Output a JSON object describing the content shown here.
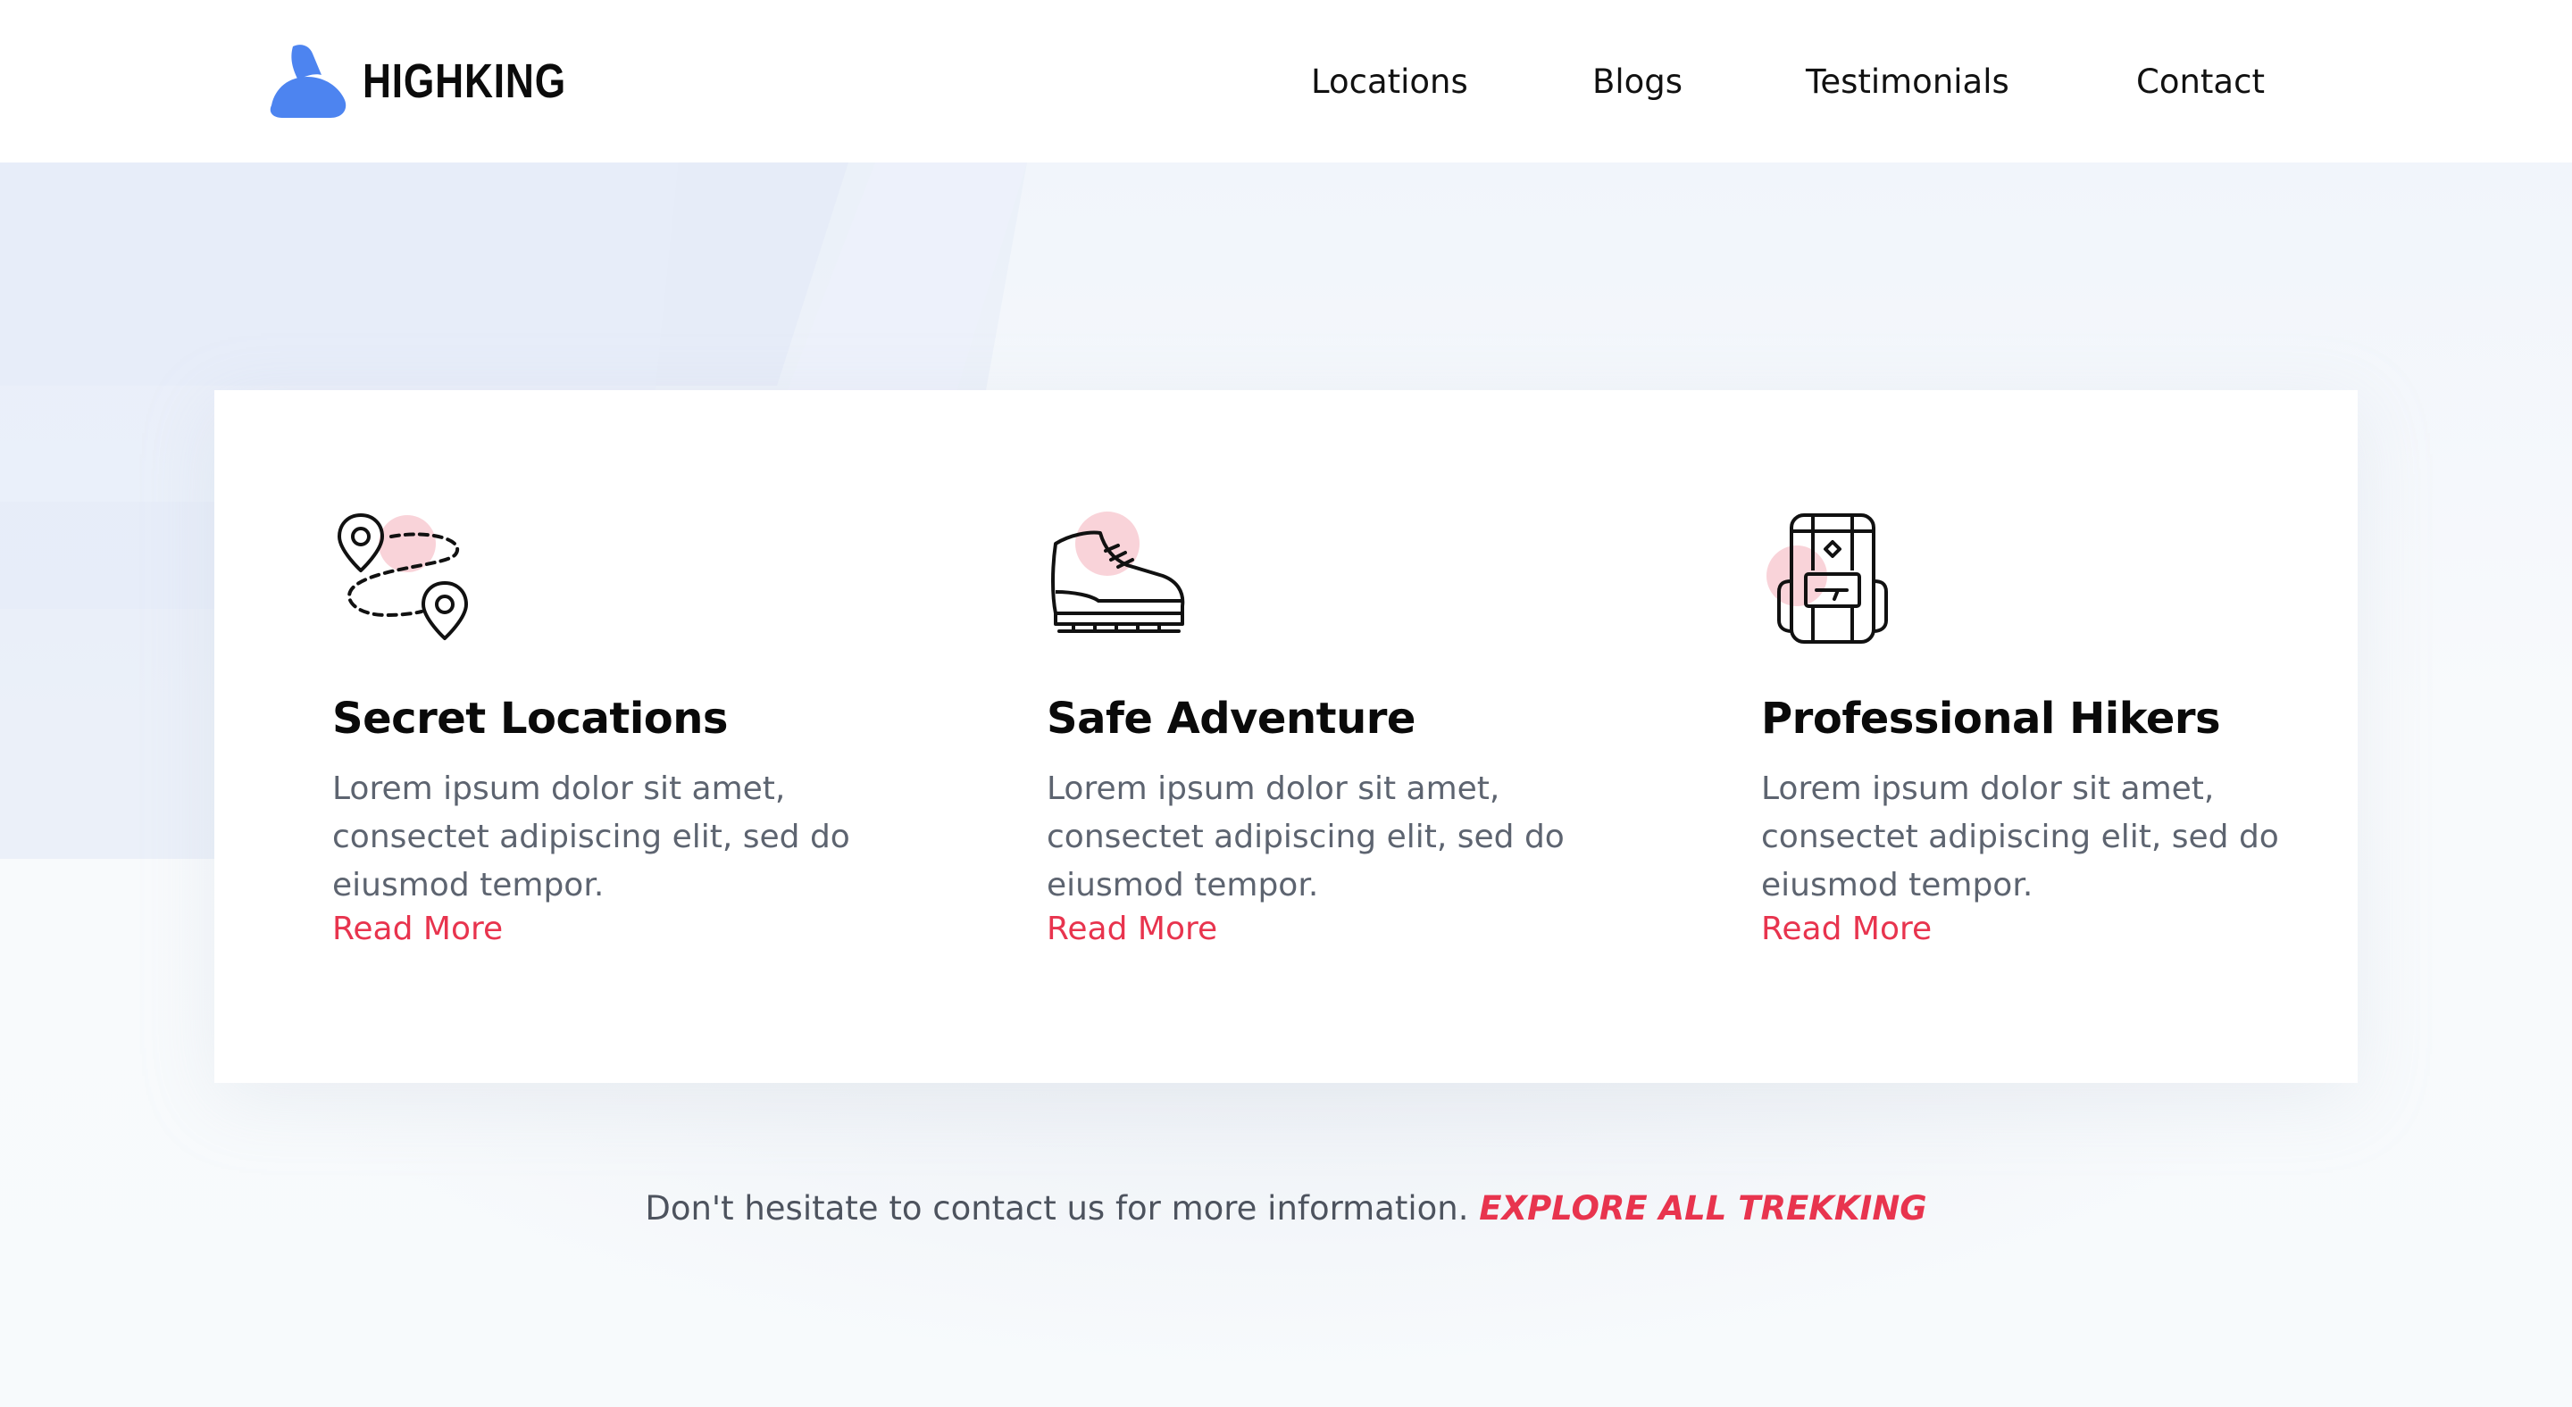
{
  "brand": {
    "name": "HIGHKING",
    "logo_icon": "mountain-logo-icon"
  },
  "nav": {
    "items": [
      {
        "label": "Locations"
      },
      {
        "label": "Blogs"
      },
      {
        "label": "Testimonials"
      },
      {
        "label": "Contact"
      }
    ]
  },
  "features": [
    {
      "icon": "map-route-icon",
      "title": "Secret Locations",
      "description": "Lorem ipsum dolor sit amet, consectet adipiscing elit, sed do eiusmod tempor.",
      "link": "Read More"
    },
    {
      "icon": "hiking-boot-icon",
      "title": "Safe Adventure",
      "description": "Lorem ipsum dolor sit amet, consectet adipiscing elit, sed do eiusmod tempor.",
      "link": "Read More"
    },
    {
      "icon": "backpack-icon",
      "title": "Professional Hikers",
      "description": "Lorem ipsum dolor sit amet, consectet adipiscing elit, sed do eiusmod tempor.",
      "link": "Read More"
    }
  ],
  "footer_cta": {
    "text": "Don't hesitate to contact us for more information.",
    "link": "EXPLORE ALL TREKKING"
  },
  "colors": {
    "accent": "#e8344e",
    "brand_blue": "#4d84f0",
    "icon_highlight": "#f9d3d9",
    "text_muted": "#5d6470"
  }
}
